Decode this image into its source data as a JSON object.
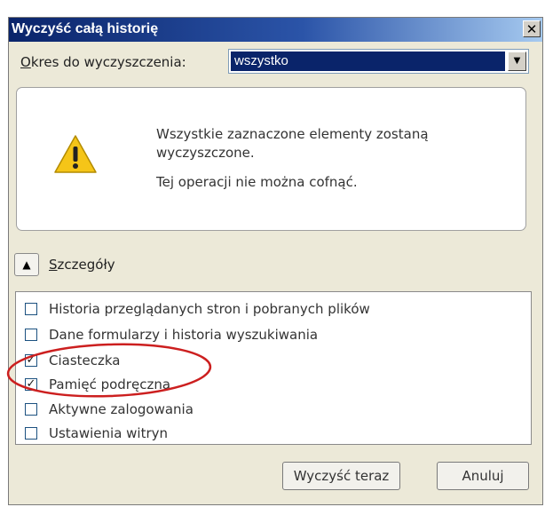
{
  "dialog": {
    "title": "Wyczyść całą historię",
    "close_glyph": "✕"
  },
  "period": {
    "label_accel": "O",
    "label_rest": "kres do wyczyszczenia:",
    "selected": "wszystko",
    "arrow": "▼"
  },
  "warning": {
    "icon": "warning-icon",
    "line1": "Wszystkie zaznaczone elementy zostaną wyczyszczone.",
    "line2": "Tej operacji nie można cofnąć."
  },
  "details": {
    "toggle_glyph": "▲",
    "label_accel": "S",
    "label_rest": "zczegóły"
  },
  "items": [
    {
      "label": "Historia przeglądanych stron i pobranych plików",
      "checked": false
    },
    {
      "label": "Dane formularzy i historia wyszukiwania",
      "checked": false
    },
    {
      "label": "Ciasteczka",
      "checked": true
    },
    {
      "label": "Pamięć podręczna",
      "checked": true
    },
    {
      "label": "Aktywne zalogowania",
      "checked": false
    },
    {
      "label": "Ustawienia witryn",
      "checked": false
    }
  ],
  "buttons": {
    "clear": "Wyczyść teraz",
    "cancel": "Anuluj"
  },
  "colors": {
    "titlebar": "#0a246a",
    "annotation": "#cc1f1f",
    "warning_fill": "#f5c518"
  }
}
